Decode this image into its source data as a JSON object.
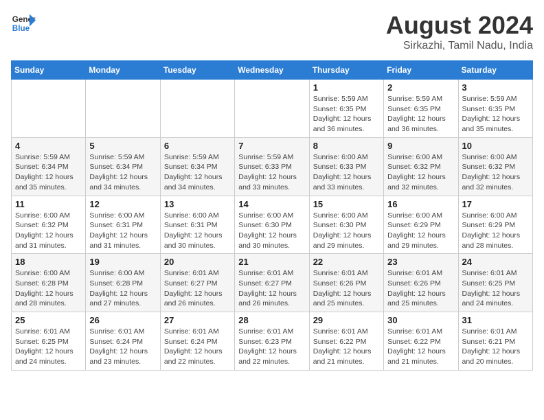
{
  "logo": {
    "line1": "General",
    "line2": "Blue"
  },
  "title": "August 2024",
  "subtitle": "Sirkazhi, Tamil Nadu, India",
  "days_of_week": [
    "Sunday",
    "Monday",
    "Tuesday",
    "Wednesday",
    "Thursday",
    "Friday",
    "Saturday"
  ],
  "weeks": [
    [
      {
        "day": "",
        "info": ""
      },
      {
        "day": "",
        "info": ""
      },
      {
        "day": "",
        "info": ""
      },
      {
        "day": "",
        "info": ""
      },
      {
        "day": "1",
        "info": "Sunrise: 5:59 AM\nSunset: 6:35 PM\nDaylight: 12 hours\nand 36 minutes."
      },
      {
        "day": "2",
        "info": "Sunrise: 5:59 AM\nSunset: 6:35 PM\nDaylight: 12 hours\nand 36 minutes."
      },
      {
        "day": "3",
        "info": "Sunrise: 5:59 AM\nSunset: 6:35 PM\nDaylight: 12 hours\nand 35 minutes."
      }
    ],
    [
      {
        "day": "4",
        "info": "Sunrise: 5:59 AM\nSunset: 6:34 PM\nDaylight: 12 hours\nand 35 minutes."
      },
      {
        "day": "5",
        "info": "Sunrise: 5:59 AM\nSunset: 6:34 PM\nDaylight: 12 hours\nand 34 minutes."
      },
      {
        "day": "6",
        "info": "Sunrise: 5:59 AM\nSunset: 6:34 PM\nDaylight: 12 hours\nand 34 minutes."
      },
      {
        "day": "7",
        "info": "Sunrise: 5:59 AM\nSunset: 6:33 PM\nDaylight: 12 hours\nand 33 minutes."
      },
      {
        "day": "8",
        "info": "Sunrise: 6:00 AM\nSunset: 6:33 PM\nDaylight: 12 hours\nand 33 minutes."
      },
      {
        "day": "9",
        "info": "Sunrise: 6:00 AM\nSunset: 6:32 PM\nDaylight: 12 hours\nand 32 minutes."
      },
      {
        "day": "10",
        "info": "Sunrise: 6:00 AM\nSunset: 6:32 PM\nDaylight: 12 hours\nand 32 minutes."
      }
    ],
    [
      {
        "day": "11",
        "info": "Sunrise: 6:00 AM\nSunset: 6:32 PM\nDaylight: 12 hours\nand 31 minutes."
      },
      {
        "day": "12",
        "info": "Sunrise: 6:00 AM\nSunset: 6:31 PM\nDaylight: 12 hours\nand 31 minutes."
      },
      {
        "day": "13",
        "info": "Sunrise: 6:00 AM\nSunset: 6:31 PM\nDaylight: 12 hours\nand 30 minutes."
      },
      {
        "day": "14",
        "info": "Sunrise: 6:00 AM\nSunset: 6:30 PM\nDaylight: 12 hours\nand 30 minutes."
      },
      {
        "day": "15",
        "info": "Sunrise: 6:00 AM\nSunset: 6:30 PM\nDaylight: 12 hours\nand 29 minutes."
      },
      {
        "day": "16",
        "info": "Sunrise: 6:00 AM\nSunset: 6:29 PM\nDaylight: 12 hours\nand 29 minutes."
      },
      {
        "day": "17",
        "info": "Sunrise: 6:00 AM\nSunset: 6:29 PM\nDaylight: 12 hours\nand 28 minutes."
      }
    ],
    [
      {
        "day": "18",
        "info": "Sunrise: 6:00 AM\nSunset: 6:28 PM\nDaylight: 12 hours\nand 28 minutes."
      },
      {
        "day": "19",
        "info": "Sunrise: 6:00 AM\nSunset: 6:28 PM\nDaylight: 12 hours\nand 27 minutes."
      },
      {
        "day": "20",
        "info": "Sunrise: 6:01 AM\nSunset: 6:27 PM\nDaylight: 12 hours\nand 26 minutes."
      },
      {
        "day": "21",
        "info": "Sunrise: 6:01 AM\nSunset: 6:27 PM\nDaylight: 12 hours\nand 26 minutes."
      },
      {
        "day": "22",
        "info": "Sunrise: 6:01 AM\nSunset: 6:26 PM\nDaylight: 12 hours\nand 25 minutes."
      },
      {
        "day": "23",
        "info": "Sunrise: 6:01 AM\nSunset: 6:26 PM\nDaylight: 12 hours\nand 25 minutes."
      },
      {
        "day": "24",
        "info": "Sunrise: 6:01 AM\nSunset: 6:25 PM\nDaylight: 12 hours\nand 24 minutes."
      }
    ],
    [
      {
        "day": "25",
        "info": "Sunrise: 6:01 AM\nSunset: 6:25 PM\nDaylight: 12 hours\nand 24 minutes."
      },
      {
        "day": "26",
        "info": "Sunrise: 6:01 AM\nSunset: 6:24 PM\nDaylight: 12 hours\nand 23 minutes."
      },
      {
        "day": "27",
        "info": "Sunrise: 6:01 AM\nSunset: 6:24 PM\nDaylight: 12 hours\nand 22 minutes."
      },
      {
        "day": "28",
        "info": "Sunrise: 6:01 AM\nSunset: 6:23 PM\nDaylight: 12 hours\nand 22 minutes."
      },
      {
        "day": "29",
        "info": "Sunrise: 6:01 AM\nSunset: 6:22 PM\nDaylight: 12 hours\nand 21 minutes."
      },
      {
        "day": "30",
        "info": "Sunrise: 6:01 AM\nSunset: 6:22 PM\nDaylight: 12 hours\nand 21 minutes."
      },
      {
        "day": "31",
        "info": "Sunrise: 6:01 AM\nSunset: 6:21 PM\nDaylight: 12 hours\nand 20 minutes."
      }
    ]
  ]
}
